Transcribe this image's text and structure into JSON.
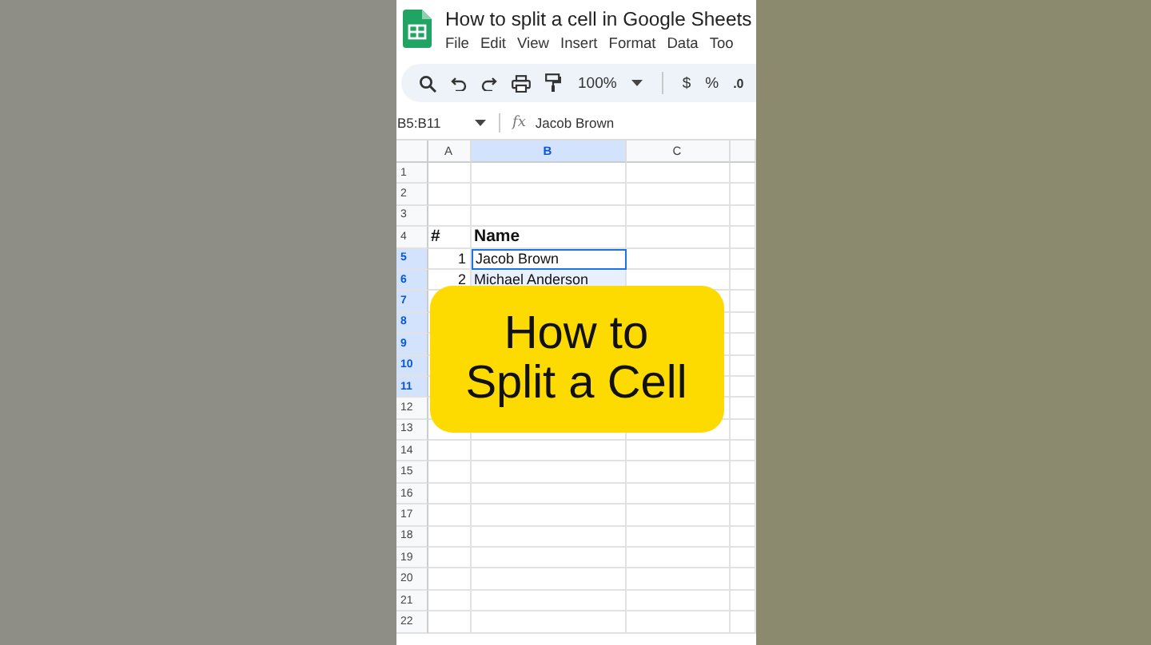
{
  "document": {
    "title": "How to split a cell in Google Sheets",
    "menu": [
      "File",
      "Edit",
      "View",
      "Insert",
      "Format",
      "Data",
      "Too"
    ]
  },
  "toolbar": {
    "zoom": "100%",
    "currency": "$",
    "percent": "%",
    "decimal": ".0"
  },
  "formula_bar": {
    "name_box": "B5:B11",
    "function_label": "fx",
    "value": "Jacob Brown"
  },
  "columns": [
    {
      "label": "A",
      "selected": false
    },
    {
      "label": "B",
      "selected": true
    },
    {
      "label": "C",
      "selected": false
    }
  ],
  "rows": [
    {
      "number": "1",
      "selected": false
    },
    {
      "number": "2",
      "selected": false
    },
    {
      "number": "3",
      "selected": false
    },
    {
      "number": "4",
      "selected": false,
      "kind": "header",
      "a": "#",
      "b": "Name"
    },
    {
      "number": "5",
      "selected": true,
      "active": true,
      "a": "1",
      "b": "Jacob Brown"
    },
    {
      "number": "6",
      "selected": true,
      "a": "2",
      "b": "Michael Anderson"
    },
    {
      "number": "7",
      "selected": true
    },
    {
      "number": "8",
      "selected": true
    },
    {
      "number": "9",
      "selected": true
    },
    {
      "number": "10",
      "selected": true
    },
    {
      "number": "11",
      "selected": true
    },
    {
      "number": "12",
      "selected": false
    },
    {
      "number": "13",
      "selected": false
    },
    {
      "number": "14",
      "selected": false
    },
    {
      "number": "15",
      "selected": false
    },
    {
      "number": "16",
      "selected": false
    },
    {
      "number": "17",
      "selected": false
    },
    {
      "number": "18",
      "selected": false
    },
    {
      "number": "19",
      "selected": false
    },
    {
      "number": "20",
      "selected": false
    },
    {
      "number": "21",
      "selected": false
    },
    {
      "number": "22",
      "selected": false
    }
  ],
  "overlay": {
    "lines": [
      "How to",
      "Split a Cell"
    ]
  }
}
